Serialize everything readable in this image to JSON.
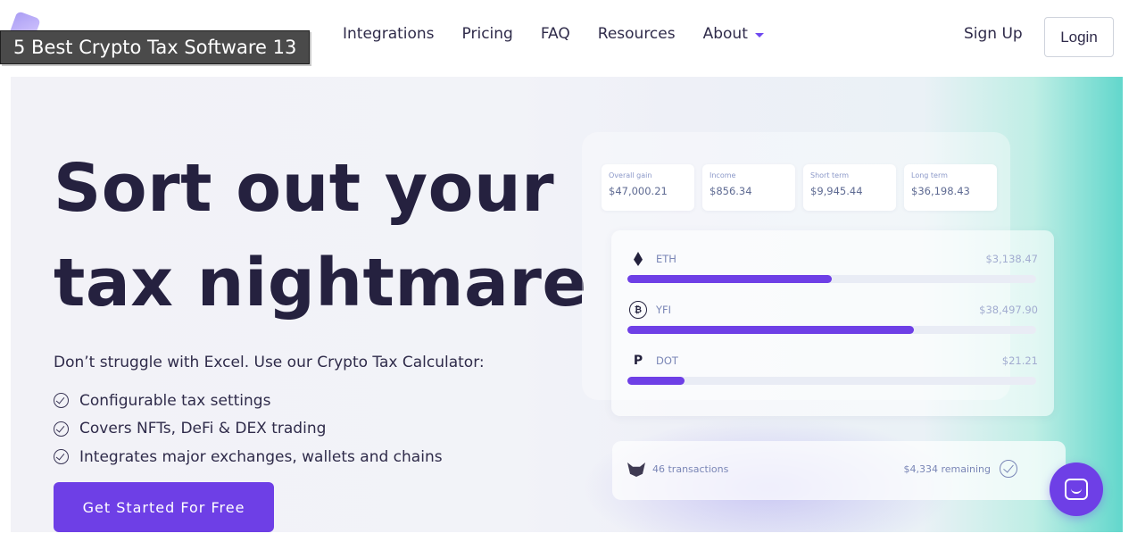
{
  "overlay_title": "5 Best Crypto Tax Software 13",
  "nav": {
    "links": [
      "Integrations",
      "Pricing",
      "FAQ",
      "Resources"
    ],
    "about_label": "About",
    "signup_label": "Sign Up",
    "login_label": "Login"
  },
  "hero": {
    "headline_line1": "Sort out your",
    "headline_line2": "tax nightmare",
    "subhead": "Don’t struggle with Excel. Use our Crypto Tax Calculator:",
    "features": [
      "Configurable tax settings",
      "Covers NFTs, DeFi & DEX trading",
      "Integrates major exchanges, wallets and chains"
    ],
    "cta_label": "Get Started For Free"
  },
  "dashboard": {
    "stats": [
      {
        "label": "Overall gain",
        "value": "$47,000.21"
      },
      {
        "label": "Income",
        "value": "$856.34"
      },
      {
        "label": "Short term",
        "value": "$9,945.44"
      },
      {
        "label": "Long term",
        "value": "$36,198.43"
      }
    ],
    "coins": [
      {
        "name": "ETH",
        "value": "$3,138.47",
        "progress": 0.5,
        "icon": "ethereum-icon"
      },
      {
        "name": "YFI",
        "value": "$38,497.90",
        "progress": 0.7,
        "icon": "yfi-icon"
      },
      {
        "name": "DOT",
        "value": "$21.21",
        "progress": 0.14,
        "icon": "polkadot-icon"
      }
    ],
    "transactions": {
      "count_label": "46 transactions",
      "remaining_label": "$4,334 remaining"
    }
  },
  "colors": {
    "accent": "#6e3fe6",
    "heading": "#25213f",
    "teal": "#62d7cc"
  }
}
